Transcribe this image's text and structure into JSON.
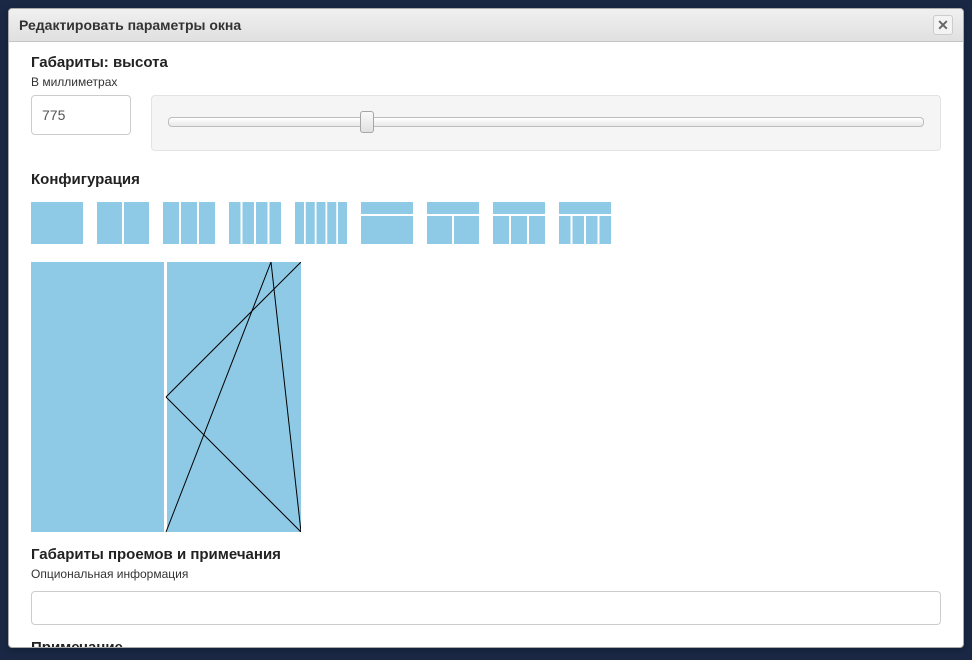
{
  "dialog": {
    "title": "Редактировать параметры окна",
    "close_char": "✕"
  },
  "height": {
    "section_label": "Габариты: высота",
    "sub_label": "В миллиметрах",
    "value": "775",
    "slider_min": "0",
    "slider_max": "3000",
    "slider_value": "775"
  },
  "configuration": {
    "section_label": "Конфигурация"
  },
  "openings": {
    "section_label": "Габариты проемов и примечания",
    "sub_label": "Опциональная информация",
    "value": ""
  },
  "note": {
    "section_label": "Примечание"
  },
  "colors": {
    "pane": "#8ecae6",
    "stroke": "#ffffff",
    "diag": "#000000"
  }
}
